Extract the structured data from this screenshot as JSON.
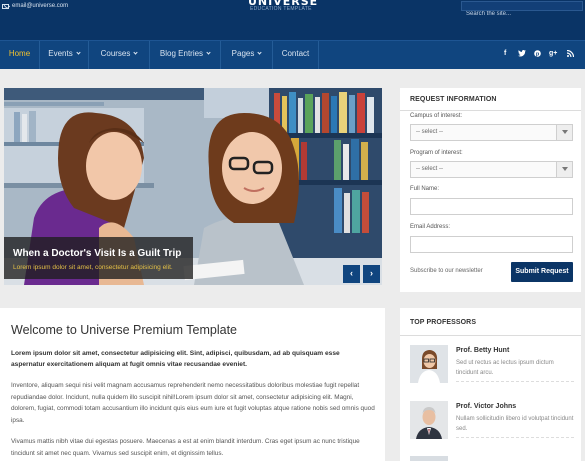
{
  "topbar": {
    "email": "email@universe.com",
    "logo_word": "UNIVERSE",
    "logo_sub": "EDUCATION TEMPLATE",
    "search_placeholder": "Search the site..."
  },
  "nav": {
    "items": [
      "Home",
      "Events",
      "Courses",
      "Blog Entries",
      "Pages",
      "Contact"
    ],
    "active": "Home",
    "social": [
      "f",
      "t",
      "p",
      "g+",
      "rss"
    ]
  },
  "slider": {
    "caption_title": "When a Doctor's Visit Is a Guilt Trip",
    "caption_text": "Lorem ipsum dolor sit amet, consectetur adipisicing elit.",
    "prev_label": "‹",
    "next_label": "›"
  },
  "request": {
    "title": "REQUEST INFORMATION",
    "campus_label": "Campus of interest:",
    "campus_value": "-- select --",
    "program_label": "Program of interest:",
    "program_value": "-- select --",
    "name_label": "Full Name:",
    "email_label": "Email Address:",
    "subscribe_text": "Subscribe to our newsletter",
    "submit_label": "Submit Request"
  },
  "welcome": {
    "title": "Welcome to Universe Premium Template",
    "lead": "Lorem ipsum dolor sit amet, consectetur adipisicing elit. Sint, adipisci, quibusdam, ad ab quisquam esse aspernatur exercitationem aliquam at fugit omnis vitae recusandae eveniet.",
    "p1": "Inventore, aliquam sequi nisi velit magnam accusamus reprehenderit nemo necessitatibus doloribus molestiae fugit repellat repudiandae dolor. Incidunt, nulla quidem illo suscipit nihil!Lorem ipsum dolor sit amet, consectetur adipisicing elit. Magni, dolorem, fugiat, commodi totam accusantium illo incidunt quis eius eum iure et fugit voluptas atque ratione nobis sed omnis quod ipsa.",
    "p2": "Vivamus mattis nibh vitae dui egestas posuere. Maecenas a est at enim blandit interdum. Cras eget ipsum ac nunc tristique tincidunt sit amet nec quam. Vivamus sed suscipit enim, et dignissim tellus."
  },
  "professors": {
    "title": "TOP PROFESSORS",
    "items": [
      {
        "name": "Prof. Betty Hunt",
        "desc": "Sed ut rectus ac lectus ipsum dictum tincidunt arcu."
      },
      {
        "name": "Prof. Victor Johns",
        "desc": "Nullam sollicitudin libero id volutpat tincidunt sed."
      }
    ]
  },
  "colors": {
    "topbar": "#0a3466",
    "nav": "#10457f",
    "accent": "#f2c22f",
    "button": "#0b3566"
  }
}
